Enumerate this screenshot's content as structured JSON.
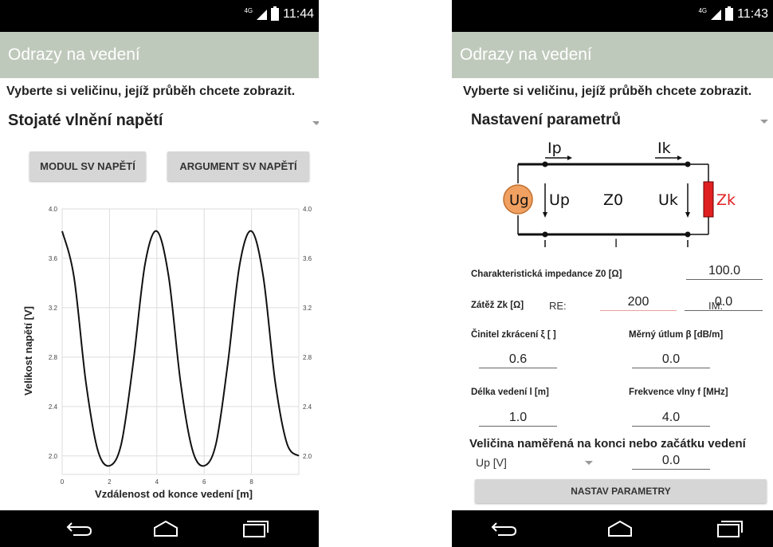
{
  "left_screen": {
    "status": {
      "network": "4G",
      "time": "11:44"
    },
    "app_title": "Odrazy na vedení",
    "prompt": "Vyberte si veličinu, jejíž průběh chcete zobrazit.",
    "selected_option": "Stojaté vlnění napětí",
    "buttons": {
      "modul": "MODUL SV NAPĚTÍ",
      "argument": "ARGUMENT SV NAPĚTÍ"
    },
    "chart_data": {
      "type": "line",
      "xlabel": "Vzdálenost od konce vedení [m]",
      "ylabel": "Velikost napětí [V]",
      "xlim": [
        0,
        10
      ],
      "ylim": [
        1.85,
        4.0
      ],
      "x_ticks": [
        "0",
        "2",
        "4",
        "6",
        "8"
      ],
      "y_ticks": [
        "4.0",
        "3.6",
        "3.2",
        "2.8",
        "2.4",
        "2.0"
      ],
      "grid": true,
      "series": [
        {
          "x": [
            0,
            0.5,
            1,
            1.5,
            2,
            2.5,
            3,
            3.5,
            4,
            4.5,
            5,
            5.5,
            6,
            6.5,
            7,
            7.5,
            8,
            8.5,
            9,
            9.5,
            10
          ],
          "y": [
            3.82,
            3.45,
            2.6,
            2.05,
            1.92,
            2.1,
            2.75,
            3.55,
            3.82,
            3.45,
            2.6,
            2.05,
            1.92,
            2.1,
            2.75,
            3.55,
            3.82,
            3.45,
            2.6,
            2.1,
            2.0
          ]
        }
      ]
    }
  },
  "right_screen": {
    "status": {
      "network": "4G",
      "time": "11:43"
    },
    "app_title": "Odrazy na vedení",
    "prompt": "Vyberte si veličinu, jejíž průběh chcete zobrazit.",
    "selected_option": "Nastavení parametrů",
    "diagram": {
      "ip": "Ip",
      "ik": "Ik",
      "ug": "Ug",
      "up": "Up",
      "z0": "Z0",
      "uk": "Uk",
      "zk": "Zk",
      "l": "l"
    },
    "fields": {
      "z0_label": "Charakteristická impedance Z0 [Ω]",
      "z0_value": "100.0",
      "zk_label": "Zátěž Zk [Ω]",
      "re_label": "RE:",
      "re_value": "200",
      "im_label": "IM:",
      "im_value": "0.0",
      "xi_label": "Činitel zkrácení ξ [ ]",
      "xi_value": "0.6",
      "beta_label": "Měrný útlum β [dB/m]",
      "beta_value": "0.0",
      "length_label": "Délka vedení l [m]",
      "length_value": "1.0",
      "freq_label": "Frekvence vlny f [MHz]",
      "freq_value": "4.0",
      "measured_label": "Veličina naměřená na konci nebo začátku vedení",
      "measured_select": "Up [V]",
      "measured_value": "0.0"
    },
    "submit_button": "NASTAV PARAMETRY"
  },
  "colors": {
    "appbar": "#bfc9bb",
    "ug_fill": "#f0a060",
    "zk_fill": "#e02020",
    "re_underline": "#e8a0a0"
  }
}
